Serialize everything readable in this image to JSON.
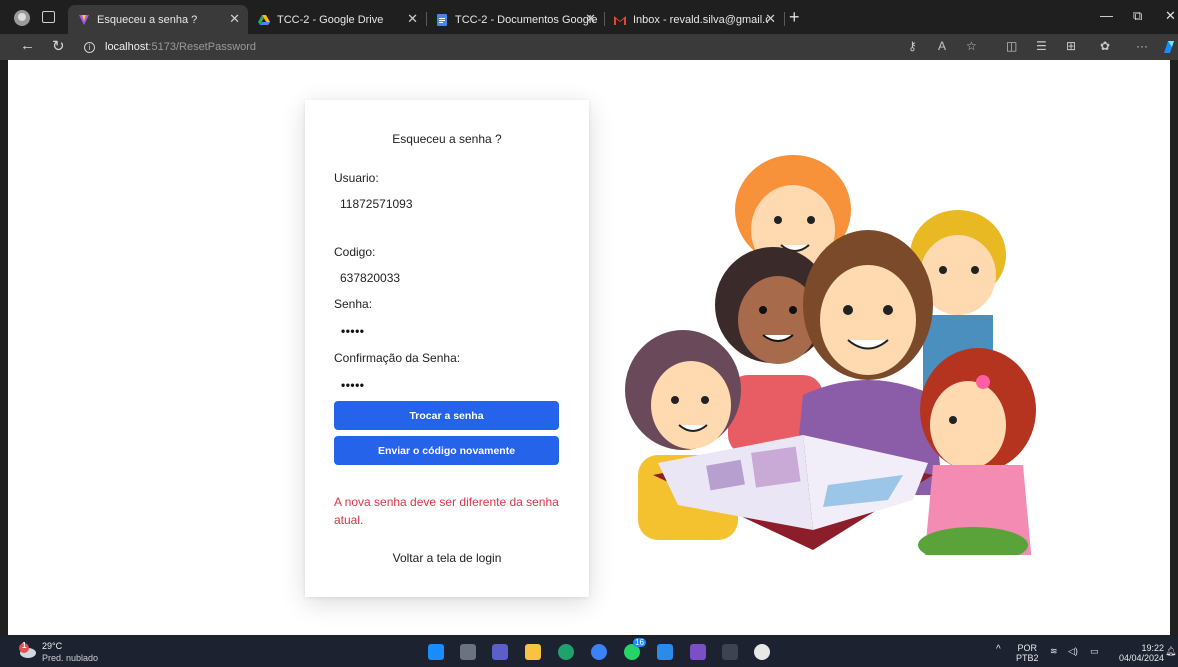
{
  "browser": {
    "tabs": [
      {
        "title": "Esqueceu a senha ?",
        "active": true,
        "favicon": "vite-icon"
      },
      {
        "title": "TCC-2 - Google Drive",
        "active": false,
        "favicon": "google-drive-icon"
      },
      {
        "title": "TCC-2 - Documentos Google",
        "active": false,
        "favicon": "google-docs-icon"
      },
      {
        "title": "Inbox - revald.silva@gmail.com",
        "active": false,
        "favicon": "gmail-icon"
      }
    ],
    "address": {
      "host": "localhost",
      "path": ":5173/ResetPassword"
    }
  },
  "form": {
    "heading": "Esqueceu a senha ?",
    "usuario_label": "Usuario:",
    "usuario_value": "11872571093",
    "codigo_label": "Codigo:",
    "codigo_value": "637820033",
    "senha_label": "Senha:",
    "senha_mask": "•••••",
    "confirm_label": "Confirmação da Senha:",
    "confirm_mask": "•••••",
    "trocar_button": "Trocar a senha",
    "reenviar_button": "Enviar o código novamente",
    "error_message": "A nova senha deve ser diferente da senha atual.",
    "back_link": "Voltar a tela de login"
  },
  "taskbar": {
    "weather_temp": "29°C",
    "weather_desc": "Pred. nublado",
    "weather_badge": "1",
    "lang_top": "POR",
    "lang_bottom": "PTB2",
    "time": "19:22",
    "date": "04/04/2024",
    "whatsapp_badge": "16"
  },
  "colors": {
    "primary_button": "#2563eb",
    "error_text": "#dc3545"
  }
}
